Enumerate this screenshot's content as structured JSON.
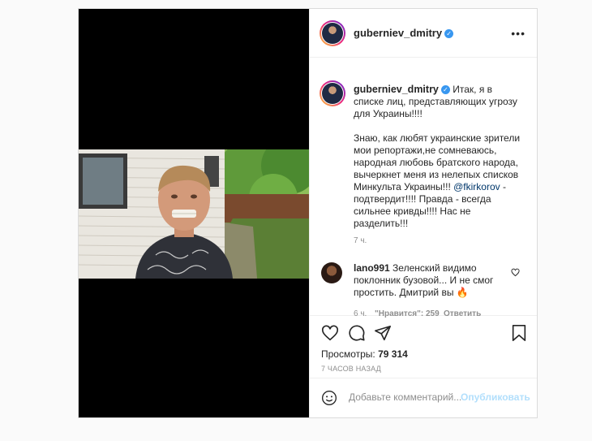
{
  "post": {
    "author": {
      "username": "guberniev_dmitry",
      "verified": true
    },
    "caption": {
      "text_part1": "Итак, я в списке лиц, представляющих угрозу для Украины!!!!\n\nЗнаю, как любят украинские зрители мои репортажи,не сомневаюсь, народная любовь братского народа, вычеркнет меня из нелепых списков Минкульта Украины!!! ",
      "mention": "@fkirkorov",
      "text_part2": " - подтвердит!!!! Правда - всегда сильнее кривды!!!! Нас не разделить!!!",
      "time": "7 ч."
    },
    "comments": [
      {
        "username": "lano991",
        "text": "Зеленский видимо поклонник бузовой... И не смог простить. Дмитрий вы 🔥",
        "time": "6 ч.",
        "likes": "\"Нравится\": 259",
        "reply_label": "Ответить"
      }
    ],
    "views_label": "Просмотры:",
    "views_count": "79 314",
    "date_ago": "7 ЧАСОВ НАЗАД",
    "add_comment": {
      "placeholder": "Добавьте комментарий...",
      "publish_label": "Опубликовать"
    },
    "icons": {
      "more": "more-horizontal-icon",
      "like": "heart-icon",
      "comment": "comment-bubble-icon",
      "share": "paper-plane-icon",
      "save": "bookmark-icon",
      "emoji": "smiley-icon",
      "comment_like": "small-heart-icon"
    },
    "colors": {
      "link": "#00376b",
      "verified": "#3897f0",
      "publish_disabled": "#b2dffc",
      "muted": "#8e8e8e"
    }
  }
}
